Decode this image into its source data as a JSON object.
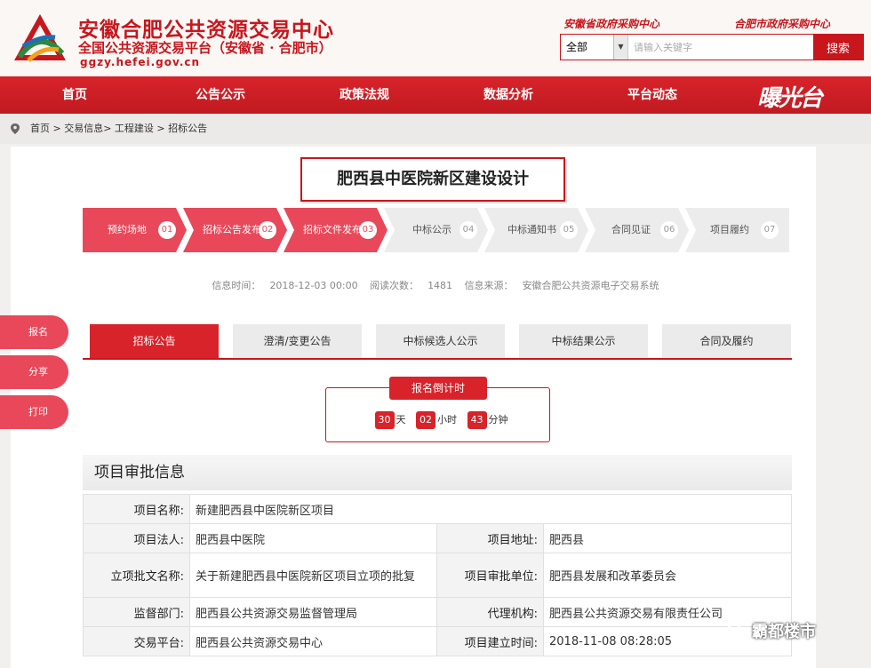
{
  "header": {
    "title": "安徽合肥公共资源交易中心",
    "subtitle": "全国公共资源交易平台（安徽省 · 合肥市）",
    "url": "ggzy.hefei.gov.cn",
    "link_province": "安徽省政府采购中心",
    "link_city": "合肥市政府采购中心",
    "search": {
      "select_value": "全部",
      "placeholder": "请输入关键字",
      "button": "搜索"
    }
  },
  "nav": {
    "items": [
      "首页",
      "公告公示",
      "政策法规",
      "数据分析",
      "平台动态"
    ],
    "brand": "曝光台"
  },
  "breadcrumb": "首页 > 交易信息> 工程建设 > 招标公告",
  "page_title": "肥西县中医院新区建设设计",
  "steps": [
    {
      "label": "预约场地",
      "num": "01",
      "active": true
    },
    {
      "label": "招标公告发布",
      "num": "02",
      "active": true
    },
    {
      "label": "招标文件发布",
      "num": "03",
      "active": true
    },
    {
      "label": "中标公示",
      "num": "04",
      "active": false
    },
    {
      "label": "中标通知书",
      "num": "05",
      "active": false
    },
    {
      "label": "合同见证",
      "num": "06",
      "active": false
    },
    {
      "label": "项目履约",
      "num": "07",
      "active": false
    }
  ],
  "meta": {
    "time_label": "信息时间：",
    "time_value": "2018-12-03 00:00",
    "views_label": "阅读次数：",
    "views_value": "1481",
    "source_label": "信息来源：",
    "source_value": "安徽合肥公共资源电子交易系统"
  },
  "side": [
    "报名",
    "分享",
    "打印"
  ],
  "tabs": [
    "招标公告",
    "澄清/变更公告",
    "中标候选人公示",
    "中标结果公示",
    "合同及履约"
  ],
  "countdown": {
    "title": "报名倒计时",
    "days": "30",
    "days_unit": "天",
    "hours": "02",
    "hours_unit": "小时",
    "minutes": "43",
    "minutes_unit": "分钟"
  },
  "section_title": "项目审批信息",
  "info": {
    "project_name_k": "项目名称:",
    "project_name_v": "新建肥西县中医院新区项目",
    "legal_k": "项目法人:",
    "legal_v": "肥西县中医院",
    "address_k": "项目地址:",
    "address_v": "肥西县",
    "approval_doc_k": "立项批文名称:",
    "approval_doc_v": "关于新建肥西县中医院新区项目立项的批复",
    "approval_unit_k": "项目审批单位:",
    "approval_unit_v": "肥西县发展和改革委员会",
    "supervisor_k": "监督部门:",
    "supervisor_v": "肥西县公共资源交易监督管理局",
    "agency_k": "代理机构:",
    "agency_v": "肥西县公共资源交易有限责任公司",
    "platform_k": "交易平台:",
    "platform_v": "肥西县公共资源交易中心",
    "created_k": "项目建立时间:",
    "created_v": "2018-11-08 08:28:05"
  },
  "watermark": "霸都楼市"
}
